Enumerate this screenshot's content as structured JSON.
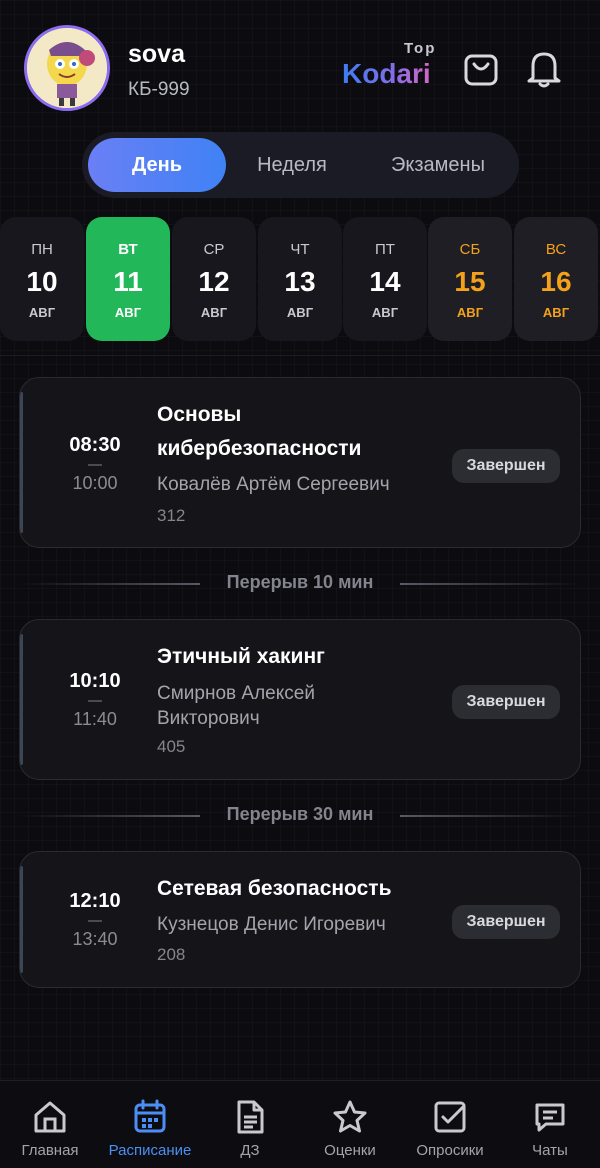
{
  "user": {
    "name": "sova",
    "group": "КБ-999"
  },
  "brand": {
    "top": "Top",
    "name": "Kodari"
  },
  "tabs": [
    {
      "label": "День",
      "active": true
    },
    {
      "label": "Неделя",
      "active": false
    },
    {
      "label": "Экзамены",
      "active": false
    }
  ],
  "days": [
    {
      "name": "ПН",
      "num": "10",
      "month": "АВГ",
      "state": "normal"
    },
    {
      "name": "ВТ",
      "num": "11",
      "month": "АВГ",
      "state": "selected"
    },
    {
      "name": "СР",
      "num": "12",
      "month": "АВГ",
      "state": "normal"
    },
    {
      "name": "ЧТ",
      "num": "13",
      "month": "АВГ",
      "state": "normal"
    },
    {
      "name": "ПТ",
      "num": "14",
      "month": "АВГ",
      "state": "normal"
    },
    {
      "name": "СБ",
      "num": "15",
      "month": "АВГ",
      "state": "weekend"
    },
    {
      "name": "ВС",
      "num": "16",
      "month": "АВГ",
      "state": "weekend"
    }
  ],
  "lessons": [
    {
      "start": "08:30",
      "end": "10:00",
      "title": "Основы кибербезопасности",
      "teacher": "Ковалёв Артём Сергеевич",
      "room": "312",
      "status": "Завершен"
    },
    {
      "start": "10:10",
      "end": "11:40",
      "title": "Этичный хакинг",
      "teacher": "Смирнов Алексей Викторович",
      "room": "405",
      "status": "Завершен"
    },
    {
      "start": "12:10",
      "end": "13:40",
      "title": "Сетевая безопасность",
      "teacher": "Кузнецов Денис Игоревич",
      "room": "208",
      "status": "Завершен"
    }
  ],
  "breaks": [
    {
      "label": "Перерыв 10 мин"
    },
    {
      "label": "Перерыв 30 мин"
    }
  ],
  "nav": [
    {
      "label": "Главная",
      "icon": "home-icon",
      "active": false
    },
    {
      "label": "Расписание",
      "icon": "calendar-icon",
      "active": true
    },
    {
      "label": "ДЗ",
      "icon": "document-icon",
      "active": false
    },
    {
      "label": "Оценки",
      "icon": "star-icon",
      "active": false
    },
    {
      "label": "Опросики",
      "icon": "checkbox-icon",
      "active": false
    },
    {
      "label": "Чаты",
      "icon": "chat-icon",
      "active": false
    }
  ],
  "colors": {
    "accent": "#3f82f5",
    "selected_day": "#22b85a",
    "weekend": "#f4a21a",
    "background": "#0b0b10"
  }
}
